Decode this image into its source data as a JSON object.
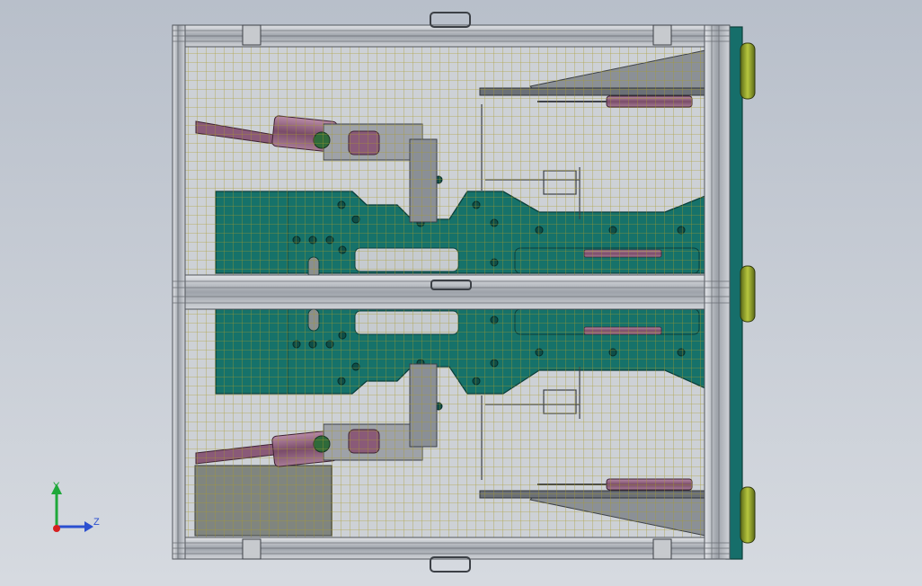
{
  "viewport": {
    "background_top": "#b8bfca",
    "background_bottom": "#d6dae0"
  },
  "colors": {
    "frame": "#a9adb3",
    "frame_dark": "#5d6168",
    "plate": "#16726a",
    "plate_edge": "#0c3f3a",
    "mesh": "#b5a21a",
    "cylinder": "#8a5a78",
    "wheel": "#7b8c2a",
    "steel": "#9aa0a8",
    "gray_block": "#80857f",
    "axis_x": "#d62020",
    "axis_y": "#1fa83a",
    "axis_z": "#2b4fd0"
  },
  "triad": {
    "y_label": "Y",
    "z_label": "Z"
  }
}
